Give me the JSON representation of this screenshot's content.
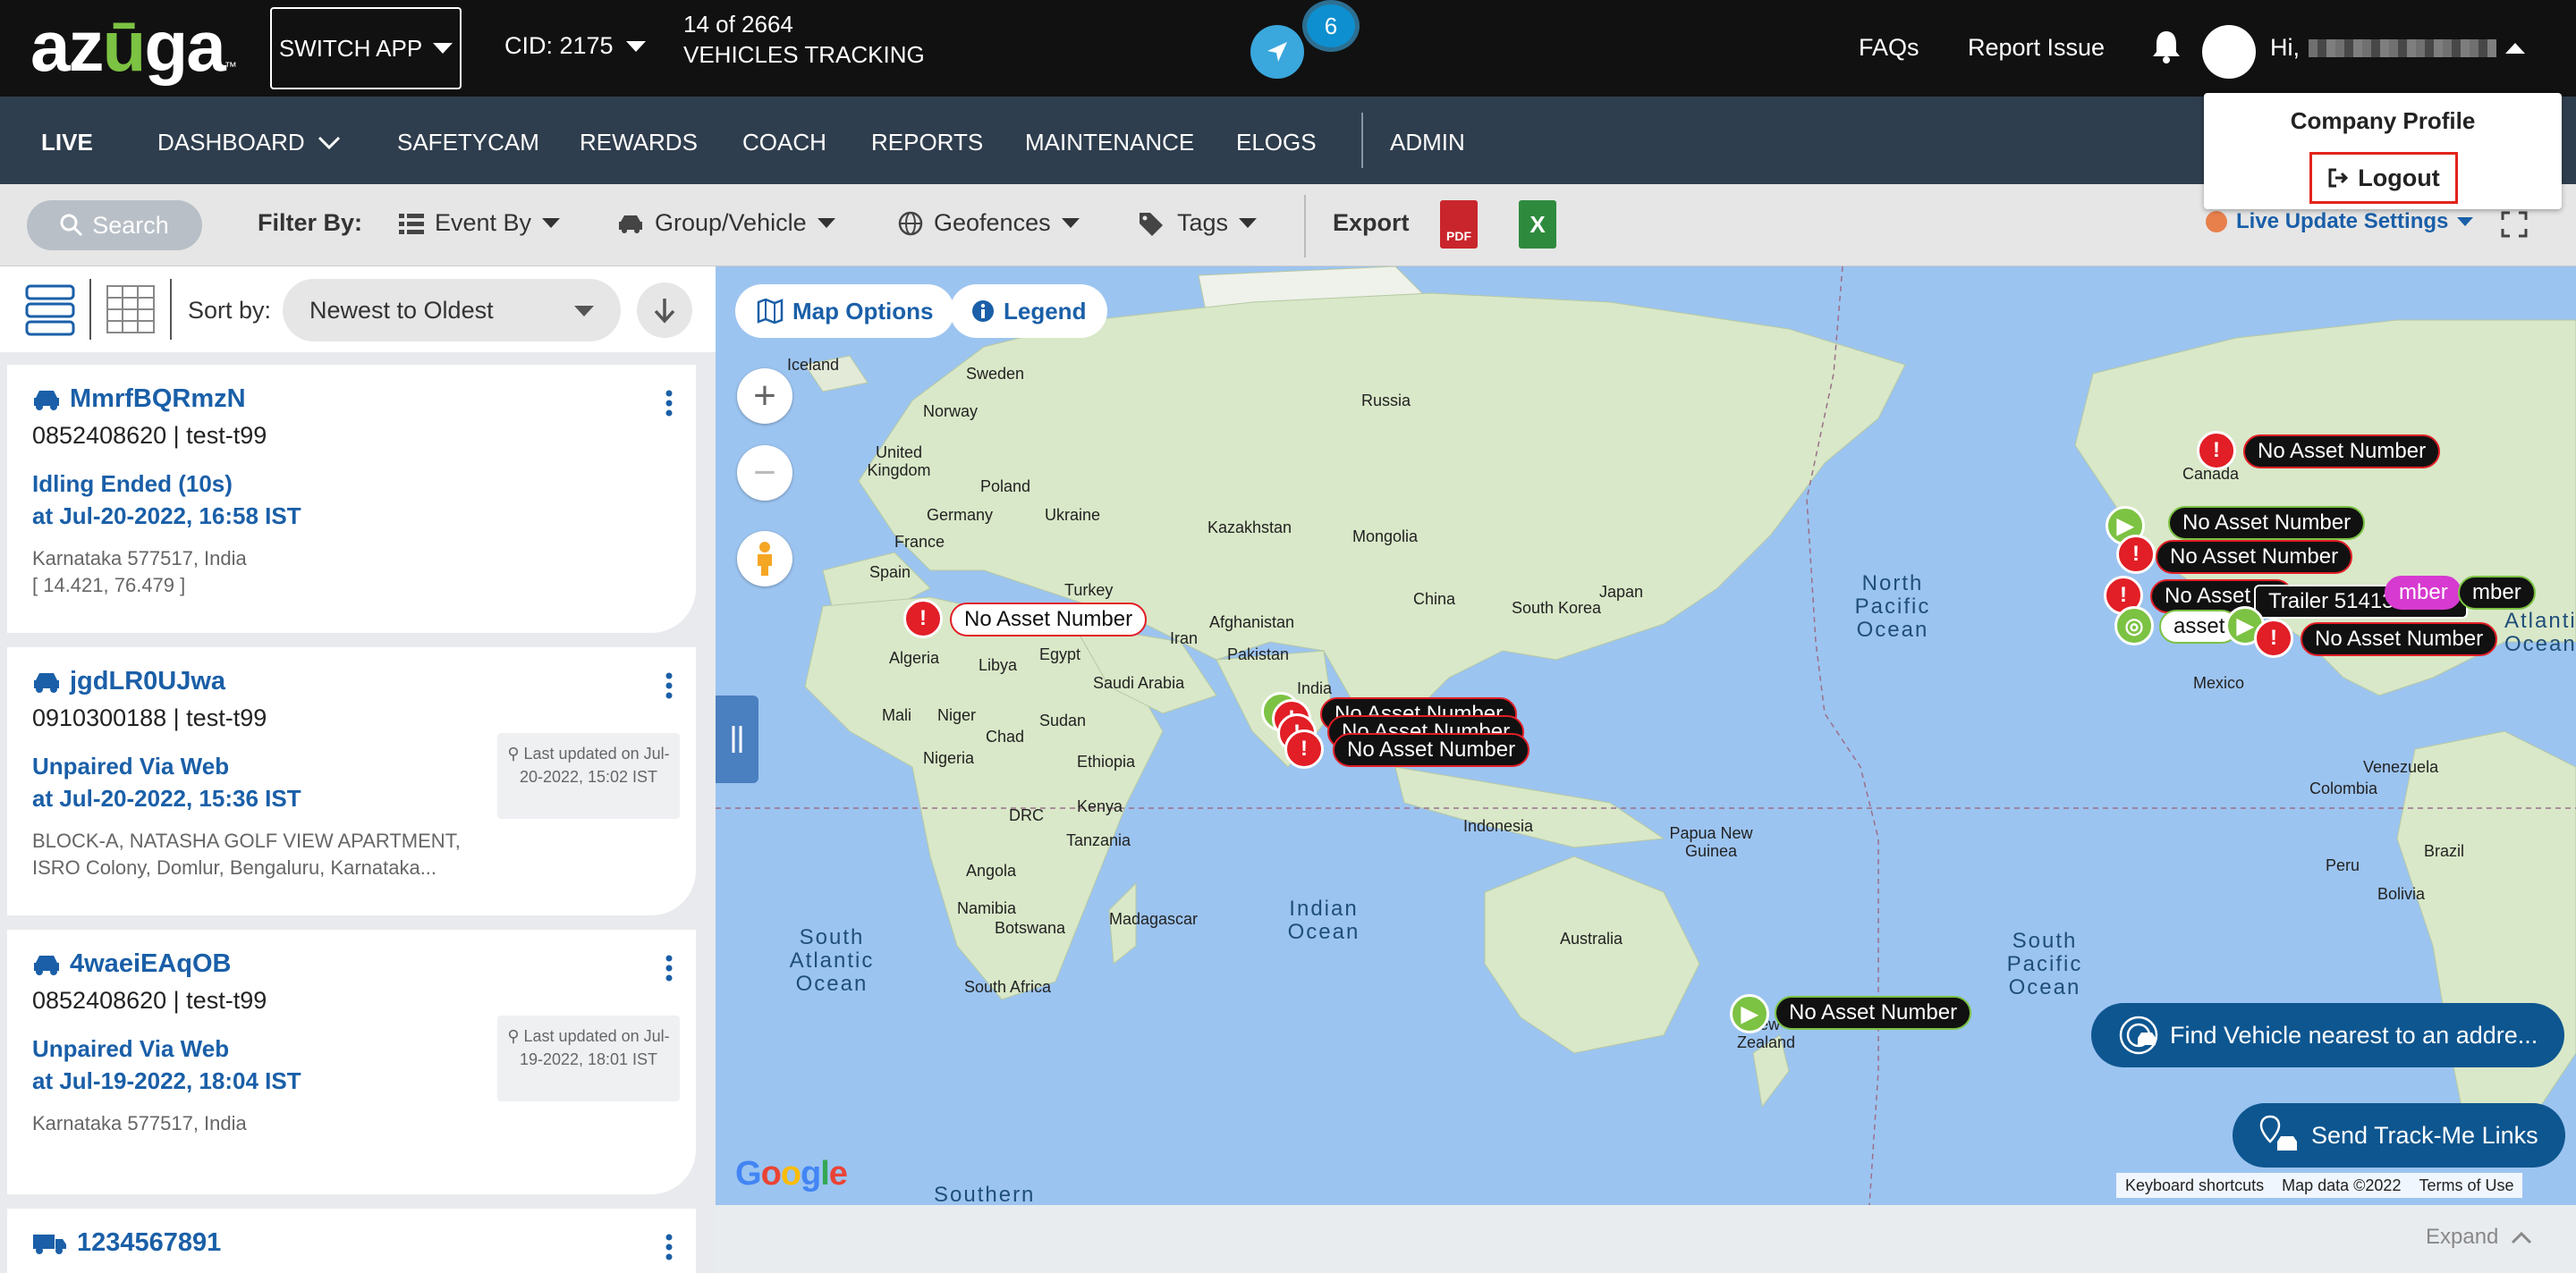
{
  "topbar": {
    "logo": {
      "left": "az",
      "u": "ū",
      "right": "ga",
      "tm": "™"
    },
    "switch_app": "SWITCH APP",
    "cid": "CID: 2175",
    "tracking_line1": "14 of 2664",
    "tracking_line2": "VEHICLES TRACKING",
    "notification_count": "6",
    "faqs": "FAQs",
    "report_issue": "Report Issue",
    "greeting": "Hi,"
  },
  "user_menu": {
    "company_profile": "Company Profile",
    "logout": "Logout"
  },
  "menu": {
    "live": "LIVE",
    "items": [
      "DASHBOARD",
      "SAFETYCAM",
      "REWARDS",
      "COACH",
      "REPORTS",
      "MAINTENANCE",
      "ELOGS",
      "ADMIN"
    ]
  },
  "filters": {
    "search": "Search",
    "filter_by": "Filter By:",
    "event_by": "Event By",
    "group_vehicle": "Group/Vehicle",
    "geofences": "Geofences",
    "tags": "Tags",
    "export": "Export",
    "excel_letter": "X",
    "pdf_letter": "PDF",
    "live_update": "Live Update Settings"
  },
  "sort": {
    "label": "Sort by:",
    "selected": "Newest to Oldest"
  },
  "vehicles": [
    {
      "name": "MmrfBQRmzN",
      "sub": "0852408620 |  test-t99",
      "event": "Idling Ended (10s)",
      "time": "at Jul-20-2022, 16:58 IST",
      "addr1": "Karnataka 577517, India",
      "addr2": "[ 14.421, 76.479 ]",
      "updated": ""
    },
    {
      "name": "jgdLR0UJwa",
      "sub": "0910300188 |  test-t99",
      "event": "Unpaired Via Web",
      "time": "at Jul-20-2022, 15:36 IST",
      "addr1": "BLOCK-A, NATASHA GOLF VIEW APARTMENT,",
      "addr2": "ISRO Colony, Domlur, Bengaluru, Karnataka...",
      "updated": "Last updated on Jul-20-2022, 15:02 IST"
    },
    {
      "name": "4waeiEAqOB",
      "sub": "0852408620 |  test-t99",
      "event": "Unpaired Via Web",
      "time": "at Jul-19-2022, 18:04 IST",
      "addr1": "Karnataka 577517, India",
      "addr2": "",
      "updated": "Last updated on Jul-19-2022, 18:01 IST"
    },
    {
      "name": "1234567891",
      "sub": "",
      "event": "",
      "time": "",
      "addr1": "",
      "addr2": "",
      "updated": ""
    }
  ],
  "map": {
    "map_options": "Map Options",
    "legend": "Legend",
    "zoom_in": "+",
    "zoom_out": "−",
    "countries": [
      "Iceland",
      "Sweden",
      "Norway",
      "Russia",
      "United Kingdom",
      "Poland",
      "Germany",
      "Ukraine",
      "Kazakhstan",
      "Mongolia",
      "France",
      "Spain",
      "Turkey",
      "China",
      "Japan",
      "South Korea",
      "Afghanistan",
      "Iran",
      "Pakistan",
      "Algeria",
      "Libya",
      "Egypt",
      "Saudi Arabia",
      "India",
      "Mali",
      "Niger",
      "Chad",
      "Sudan",
      "Nigeria",
      "Ethiopia",
      "DRC",
      "Kenya",
      "Tanzania",
      "Angola",
      "Namibia",
      "Botswana",
      "Madagascar",
      "South Africa",
      "Indonesia",
      "Papua New Guinea",
      "Australia",
      "New Zealand",
      "Canada",
      "Mexico",
      "Venezuela",
      "Colombia",
      "Brazil",
      "Peru",
      "Bolivia"
    ],
    "oceans": [
      "North Pacific Ocean",
      "Indian Ocean",
      "South Atlantic Ocean",
      "South Pacific Ocean",
      "Southern",
      "Atlantic Ocean"
    ],
    "markers": [
      "No Asset Number",
      "No Asset Number",
      "No Asset Number",
      "No Asset Number",
      "No Asset Number",
      "No Asset Number",
      "No Asset Number",
      "No Asset Number",
      "No Asset Number",
      "Trailer 5141324223",
      "asset",
      "mber"
    ],
    "find_vehicle": "Find Vehicle nearest to an addre...",
    "send_track": "Send Track-Me Links",
    "attribution": {
      "shortcuts": "Keyboard shortcuts",
      "data": "Map data ©2022",
      "terms": "Terms of Use"
    },
    "google": "Google",
    "expand": "Expand"
  }
}
